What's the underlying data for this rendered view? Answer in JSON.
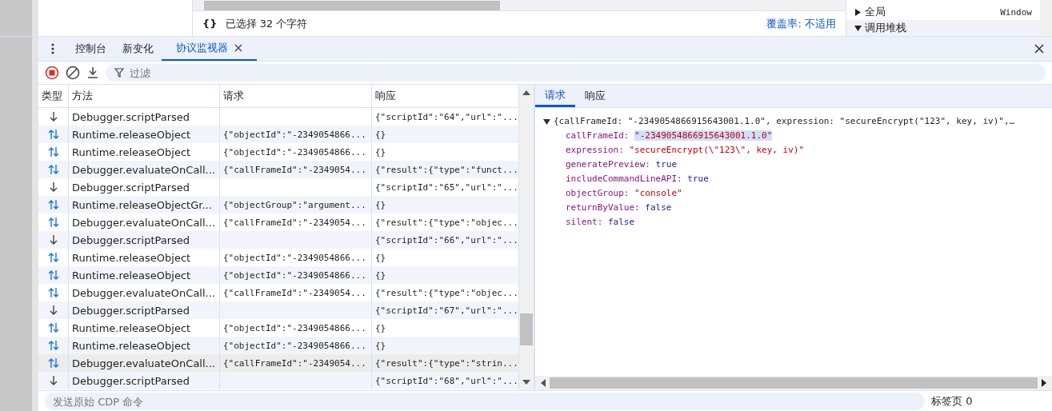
{
  "source_status": {
    "icon_text": "{}",
    "selection": "已选择 32 个字符",
    "coverage": "覆盖率: 不适用"
  },
  "scope_panel": {
    "items": [
      {
        "label": "全局",
        "value": "Window",
        "expanded": false
      },
      {
        "label": "调用堆栈",
        "value": "",
        "expanded": true
      }
    ]
  },
  "drawer_tabs": [
    {
      "label": "控制台",
      "selected": false,
      "closable": false
    },
    {
      "label": "新变化",
      "selected": false,
      "closable": false
    },
    {
      "label": "协议监视器",
      "selected": true,
      "closable": true
    }
  ],
  "toolbar": {
    "filter_placeholder": "过滤"
  },
  "table": {
    "columns": [
      "类型",
      "方法",
      "请求",
      "响应"
    ],
    "rows": [
      {
        "kind": "event",
        "method": "Debugger.scriptParsed",
        "request": "",
        "response": "{\"scriptId\":\"64\",\"url\":\"...",
        "selected": false
      },
      {
        "kind": "call",
        "method": "Runtime.releaseObject",
        "request": "{\"objectId\":\"-2349054866...",
        "response": "{}",
        "selected": false
      },
      {
        "kind": "call",
        "method": "Runtime.releaseObject",
        "request": "{\"objectId\":\"-2349054866...",
        "response": "{}",
        "selected": false
      },
      {
        "kind": "call",
        "method": "Debugger.evaluateOnCall...",
        "request": "{\"callFrameId\":\"-2349054...",
        "response": "{\"result\":{\"type\":\"funct...",
        "selected": false
      },
      {
        "kind": "event",
        "method": "Debugger.scriptParsed",
        "request": "",
        "response": "{\"scriptId\":\"65\",\"url\":\"...",
        "selected": false
      },
      {
        "kind": "call",
        "method": "Runtime.releaseObjectGr...",
        "request": "{\"objectGroup\":\"argument...",
        "response": "{}",
        "selected": false
      },
      {
        "kind": "call",
        "method": "Debugger.evaluateOnCall...",
        "request": "{\"callFrameId\":\"-2349054...",
        "response": "{\"result\":{\"type\":\"objec...",
        "selected": false
      },
      {
        "kind": "event",
        "method": "Debugger.scriptParsed",
        "request": "",
        "response": "{\"scriptId\":\"66\",\"url\":\"...",
        "selected": false
      },
      {
        "kind": "call",
        "method": "Runtime.releaseObject",
        "request": "{\"objectId\":\"-2349054866...",
        "response": "{}",
        "selected": false
      },
      {
        "kind": "call",
        "method": "Runtime.releaseObject",
        "request": "{\"objectId\":\"-2349054866...",
        "response": "{}",
        "selected": false
      },
      {
        "kind": "call",
        "method": "Debugger.evaluateOnCall...",
        "request": "{\"callFrameId\":\"-2349054...",
        "response": "{\"result\":{\"type\":\"objec...",
        "selected": false
      },
      {
        "kind": "event",
        "method": "Debugger.scriptParsed",
        "request": "",
        "response": "{\"scriptId\":\"67\",\"url\":\"...",
        "selected": false
      },
      {
        "kind": "call",
        "method": "Runtime.releaseObject",
        "request": "{\"objectId\":\"-2349054866...",
        "response": "{}",
        "selected": false
      },
      {
        "kind": "call",
        "method": "Runtime.releaseObject",
        "request": "{\"objectId\":\"-2349054866...",
        "response": "{}",
        "selected": false
      },
      {
        "kind": "call",
        "method": "Debugger.evaluateOnCall...",
        "request": "{\"callFrameId\":\"-2349054...",
        "response": "{\"result\":{\"type\":\"strin...",
        "selected": true
      },
      {
        "kind": "event",
        "method": "Debugger.scriptParsed",
        "request": "",
        "response": "{\"scriptId\":\"68\",\"url\":\"...",
        "selected": false
      }
    ]
  },
  "detail": {
    "tabs": [
      {
        "label": "请求",
        "selected": true
      },
      {
        "label": "响应",
        "selected": false
      }
    ],
    "summary": "{callFrameId: \"-2349054866915643001.1.0\", expression: \"secureEncrypt(\"123\", key, iv)\",…",
    "properties": [
      {
        "key": "callFrameId:",
        "value": "\"-2349054866915643001.1.0\"",
        "kind": "string",
        "selected": true
      },
      {
        "key": "expression:",
        "value": "\"secureEncrypt(\\\"123\\\", key, iv)\"",
        "kind": "string",
        "selected": false
      },
      {
        "key": "generatePreview:",
        "value": "true",
        "kind": "boolean",
        "selected": false
      },
      {
        "key": "includeCommandLineAPI:",
        "value": "true",
        "kind": "boolean",
        "selected": false
      },
      {
        "key": "objectGroup:",
        "value": "\"console\"",
        "kind": "string",
        "selected": false
      },
      {
        "key": "returnByValue:",
        "value": "false",
        "kind": "boolean",
        "selected": false
      },
      {
        "key": "silent:",
        "value": "false",
        "kind": "boolean",
        "selected": false
      }
    ]
  },
  "bottom_bar": {
    "command_placeholder": "发送原始 CDP 命令",
    "target": "标签页 0"
  }
}
